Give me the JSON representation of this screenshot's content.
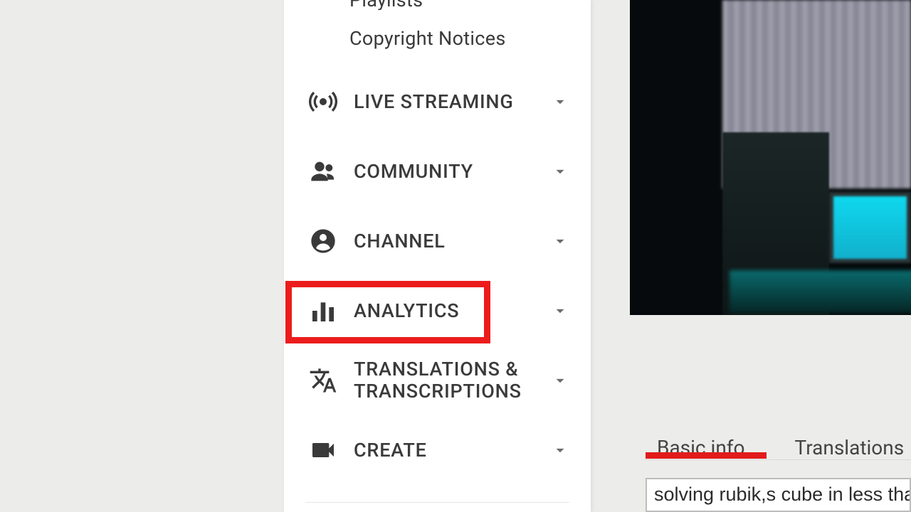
{
  "sidebar": {
    "sub_items": {
      "playlists": "Playlists",
      "copyright": "Copyright Notices"
    },
    "items": {
      "live": {
        "label": "LIVE STREAMING"
      },
      "community": {
        "label": "COMMUNITY"
      },
      "channel": {
        "label": "CHANNEL"
      },
      "analytics": {
        "label": "ANALYTICS"
      },
      "trans": {
        "label": "TRANSLATIONS &\nTRANSCRIPTIONS"
      },
      "create": {
        "label": "CREATE"
      }
    }
  },
  "content": {
    "tabs": {
      "basic": "Basic info",
      "translations": "Translations"
    },
    "title_value": "solving rubik,s cube in less tha"
  }
}
